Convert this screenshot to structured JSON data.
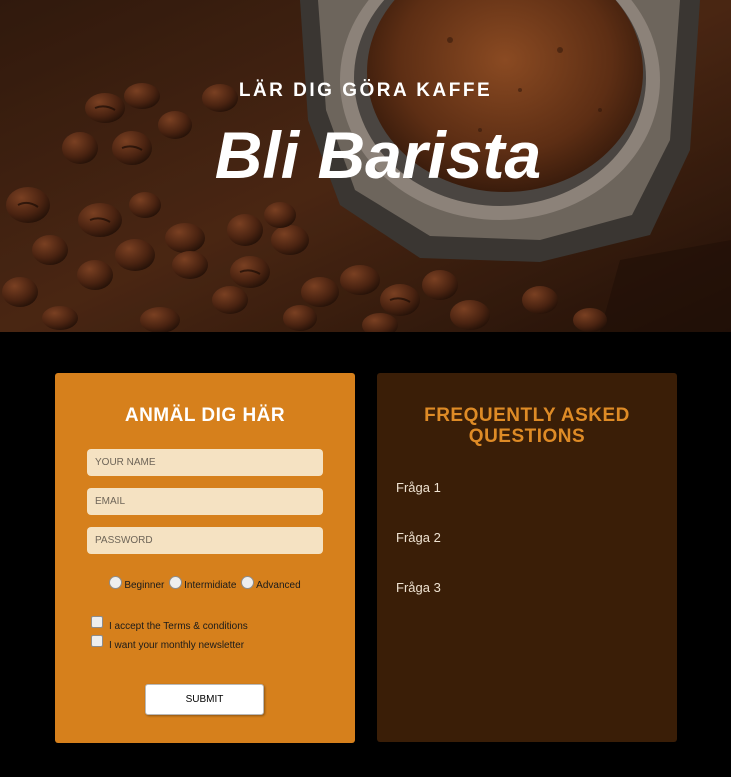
{
  "hero": {
    "kicker": "LÄR DIG GÖRA KAFFE",
    "title": "Bli Barista"
  },
  "signup": {
    "title": "ANMÄL DIG HÄR",
    "name_placeholder": "YOUR NAME",
    "email_placeholder": "EMAIL",
    "password_placeholder": "PASSWORD",
    "levels": [
      "Beginner",
      "Intermidiate",
      "Advanced"
    ],
    "checkboxes": [
      "I accept the Terms & conditions",
      "I want your monthly newsletter"
    ],
    "submit_label": "SUBMIT"
  },
  "faq": {
    "title": "FREQUENTLY ASKED QUESTIONS",
    "questions": [
      "Fråga 1",
      "Fråga 2",
      "Fråga 3"
    ]
  },
  "colors": {
    "page_bg": "#000000",
    "form_card_bg": "#d6801c",
    "input_bg": "#f5e2c2",
    "faq_card_bg": "#3a1e07",
    "faq_title": "#de8b26"
  }
}
